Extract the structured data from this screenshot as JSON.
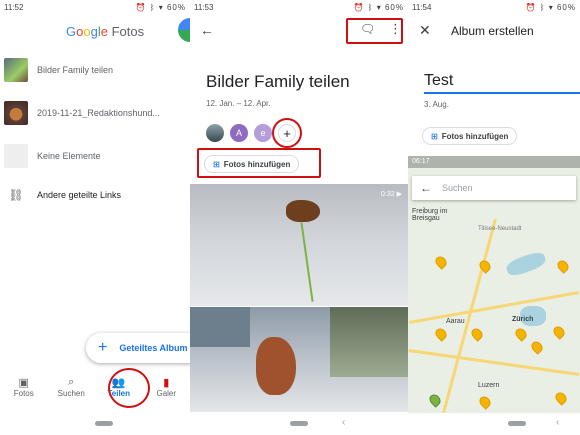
{
  "panel1": {
    "status": {
      "time": "11:52",
      "battery": "60%"
    },
    "logo": {
      "g": "G",
      "o1": "o",
      "o2": "o",
      "g2": "g",
      "l": "l",
      "e": "e",
      "rest": " Fotos"
    },
    "albums": [
      {
        "label": "Bilder Family teilen",
        "thumb_color": "#7a8a6e"
      },
      {
        "label": "2019-11-21_Redaktionshund...",
        "thumb_color": "#8a5a3a"
      },
      {
        "label": "Keine Elemente",
        "thumb_color": "#eeeeee"
      }
    ],
    "links_label": "Andere geteilte Links",
    "fab_label": "Geteiltes Album",
    "nav": [
      {
        "label": "Fotos",
        "icon": "photo-icon"
      },
      {
        "label": "Suchen",
        "icon": "search-icon"
      },
      {
        "label": "Teilen",
        "icon": "people-icon"
      },
      {
        "label": "Galer",
        "icon": "library-icon"
      }
    ]
  },
  "panel2": {
    "status": {
      "time": "11:53",
      "battery": "60%"
    },
    "title": "Bilder Family teilen",
    "date_range": "12. Jan. – 12. Apr.",
    "members": [
      {
        "initial": "",
        "color": "#5b7c99"
      },
      {
        "initial": "A",
        "color": "#8e6bbf"
      },
      {
        "initial": "e",
        "color": "#b39ddb"
      }
    ],
    "add_member": "+",
    "add_photos_label": "Fotos hinzufügen",
    "video_duration": "0:32"
  },
  "panel3": {
    "status": {
      "time": "11:54",
      "battery": "60%"
    },
    "title": "Album erstellen",
    "album_name": "Test",
    "date": "3. Aug.",
    "add_photos_label": "Fotos hinzufügen",
    "map": {
      "status_time": "06:17",
      "search_placeholder": "Suchen",
      "labels": [
        "Freiburg im Breisgau",
        "Titisee-Neustadt",
        "Aarau",
        "Zürich",
        "Luzern"
      ]
    }
  },
  "colors": {
    "accent": "#1a73e8",
    "highlight": "#d01010",
    "pin": "#f4b400"
  }
}
